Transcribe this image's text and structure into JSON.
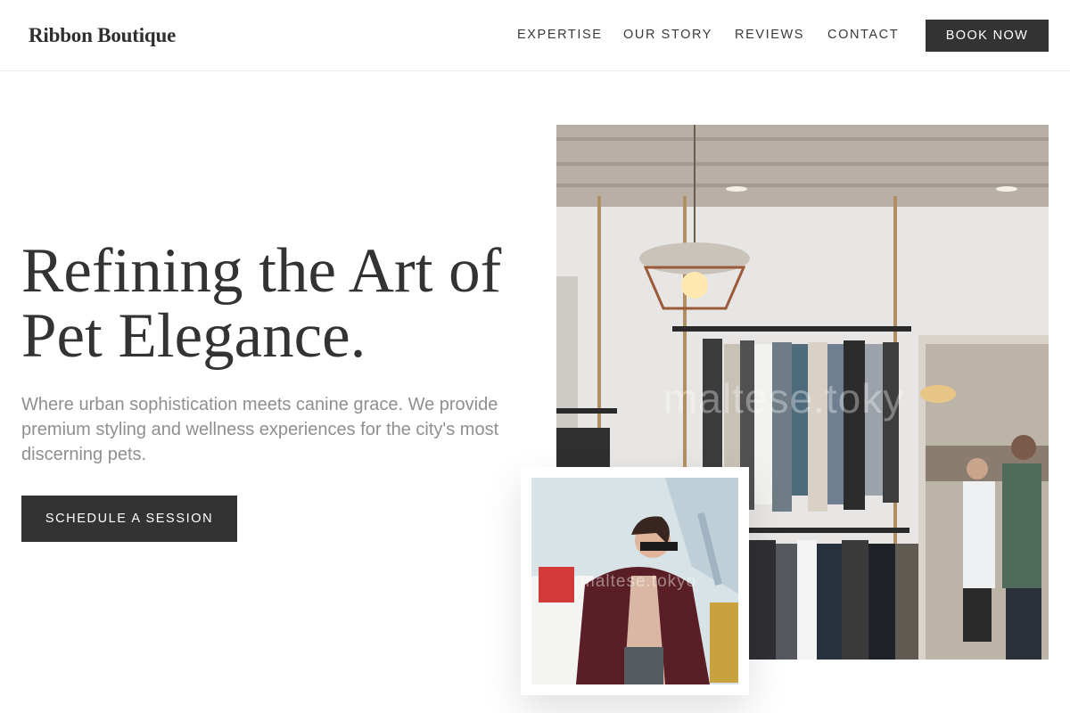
{
  "header": {
    "logo": "Ribbon Boutique",
    "nav": {
      "expertise": "EXPERTISE",
      "our_story": "OUR STORY",
      "reviews": "REVIEWS",
      "contact": "CONTACT"
    },
    "book_label": "BOOK NOW"
  },
  "hero": {
    "title": "Refining the Art of Pet Elegance.",
    "subtitle": "Where urban sophistication meets canine grace. We provide premium styling and wellness experiences for the city's most discerning pets.",
    "cta_label": "SCHEDULE A SESSION"
  },
  "images": {
    "main_watermark": "maltese.toky",
    "inset_watermark": "maltese.tokyo"
  },
  "colors": {
    "dark": "#333333",
    "muted_text": "#8f8f8f",
    "background": "#ffffff"
  }
}
